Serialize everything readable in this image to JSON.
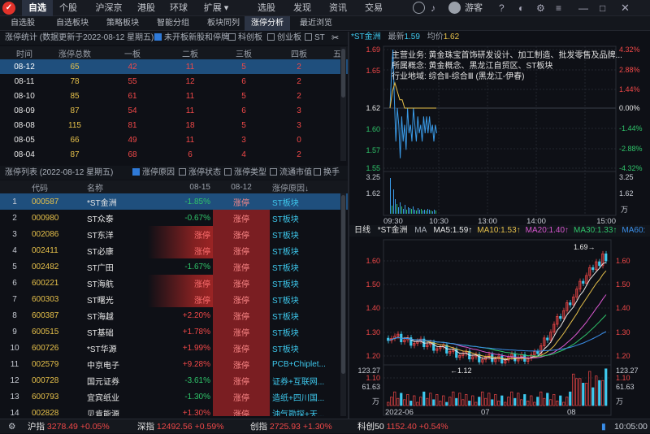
{
  "topnav": [
    "自选",
    "个股",
    "沪深京",
    "港股",
    "环球",
    "扩展 ▾",
    "选股",
    "发现",
    "资讯",
    "交易"
  ],
  "user": "游客",
  "subnav": [
    "自选股",
    "自选板块",
    "策略板块",
    "智能分组",
    "板块同列",
    "涨停分析",
    "最近浏览"
  ],
  "stats": {
    "title": "涨停统计 (数据更新于2022-08-12 星期五)",
    "filters": [
      "未开板新股和停牌",
      "科创板",
      "创业板",
      "ST"
    ],
    "headers": [
      "时间",
      "涨停总数",
      "一板",
      "二板",
      "三板",
      "四板",
      "五"
    ],
    "rows": [
      [
        "08-12",
        "65",
        "42",
        "11",
        "5",
        "2"
      ],
      [
        "08-11",
        "78",
        "55",
        "12",
        "6",
        "2"
      ],
      [
        "08-10",
        "85",
        "61",
        "11",
        "5",
        "2"
      ],
      [
        "08-09",
        "87",
        "54",
        "11",
        "6",
        "3"
      ],
      [
        "08-08",
        "115",
        "81",
        "18",
        "5",
        "3"
      ],
      [
        "08-05",
        "66",
        "49",
        "11",
        "3",
        "0"
      ],
      [
        "08-04",
        "87",
        "68",
        "6",
        "4",
        "2"
      ]
    ]
  },
  "zt": {
    "title": "涨停列表 (2022-08-12 星期五)",
    "filters": [
      "涨停原因",
      "涨停状态",
      "涨停类型",
      "流通市值",
      "换手"
    ],
    "headers": [
      "",
      "代码",
      "名称",
      "08-15",
      "08-12",
      "涨停原因↓"
    ],
    "rows": [
      [
        "1",
        "000587",
        "*ST金洲",
        "-1.85%",
        "涨停",
        "ST板块"
      ],
      [
        "2",
        "000980",
        "ST众泰",
        "-0.67%",
        "涨停",
        "ST板块"
      ],
      [
        "3",
        "002086",
        "ST东洋",
        "涨停",
        "涨停",
        "ST板块"
      ],
      [
        "4",
        "002411",
        "ST必康",
        "涨停",
        "涨停",
        "ST板块"
      ],
      [
        "5",
        "002482",
        "ST广田",
        "-1.67%",
        "涨停",
        "ST板块"
      ],
      [
        "6",
        "600221",
        "ST海航",
        "涨停",
        "涨停",
        "ST板块"
      ],
      [
        "7",
        "600303",
        "ST曙光",
        "涨停",
        "涨停",
        "ST板块"
      ],
      [
        "8",
        "600387",
        "ST海越",
        "+2.20%",
        "涨停",
        "ST板块"
      ],
      [
        "9",
        "600515",
        "ST基础",
        "+1.78%",
        "涨停",
        "ST板块"
      ],
      [
        "10",
        "600726",
        "*ST华源",
        "+1.99%",
        "涨停",
        "ST板块"
      ],
      [
        "11",
        "002579",
        "中京电子",
        "+9.28%",
        "涨停",
        "PCB+Chiplet..."
      ],
      [
        "12",
        "000728",
        "国元证券",
        "-3.61%",
        "涨停",
        "证券+互联网..."
      ],
      [
        "13",
        "600793",
        "宜宾纸业",
        "-1.30%",
        "涨停",
        "造纸+四川国..."
      ],
      [
        "14",
        "002828",
        "贝肯能源",
        "+1.30%",
        "涨停",
        "油气勘探+天..."
      ]
    ]
  },
  "intraday": {
    "name": "*ST金洲",
    "latest_label": "最新",
    "latest": "1.59",
    "avg_label": "均价",
    "avg": "1.62",
    "info": [
      "主营业务: 黄金珠宝首饰研发设计、加工制造、批发零售及品牌...",
      "所属概念: 黄金概念、黑龙江自贸区、ST板块",
      "行业地域: 综合Ⅱ-综合Ⅲ (黑龙江-伊春)"
    ],
    "price_ticks": [
      "1.69",
      "1.65",
      "1.62",
      "1.60",
      "1.57",
      "1.55"
    ],
    "pct_ticks": [
      "4.32%",
      "2.88%",
      "1.44%",
      "0.00%",
      "-1.44%",
      "-2.88%",
      "-4.32%"
    ],
    "vol_ticks": [
      "3.25",
      "1.62"
    ],
    "vol_unit": "万",
    "times": [
      "09:30",
      "10:30",
      "13:00",
      "14:00",
      "15:00"
    ]
  },
  "kline": {
    "period": "日线",
    "name": "*ST金洲",
    "ma_label": "MA",
    "ma": [
      {
        "label": "MA5:1.59↑",
        "color": "#e8e8e8"
      },
      {
        "label": "MA10:1.53↑",
        "color": "#e6c04a"
      },
      {
        "label": "MA20:1.40↑",
        "color": "#d957d0"
      },
      {
        "label": "MA30:1.33↑",
        "color": "#2fc46a"
      },
      {
        "label": "MA60:",
        "color": "#3a8ee8"
      }
    ],
    "ticks": [
      "1.60",
      "1.50",
      "1.40",
      "1.30",
      "1.20",
      "1.10"
    ],
    "high_label": "1.69→",
    "low_label": "←1.12",
    "vol_ticks": [
      "123.27",
      "61.63"
    ],
    "vol_unit": "万",
    "dates": [
      "2022-06",
      "07",
      "08"
    ]
  },
  "status": {
    "items": [
      {
        "name": "沪指",
        "value": "3278.49",
        "pct": "+0.05%"
      },
      {
        "name": "深指",
        "value": "12492.56",
        "pct": "+0.59%"
      },
      {
        "name": "创指",
        "value": "2725.93",
        "pct": "+1.30%"
      },
      {
        "name": "科创50",
        "value": "1152.40",
        "pct": "+0.54%"
      }
    ],
    "time": "10:05:00"
  },
  "colors": {
    "up": "#f04848",
    "down": "#2fc46a",
    "accent": "#3ec9ee",
    "select": "#1f4f7d"
  }
}
